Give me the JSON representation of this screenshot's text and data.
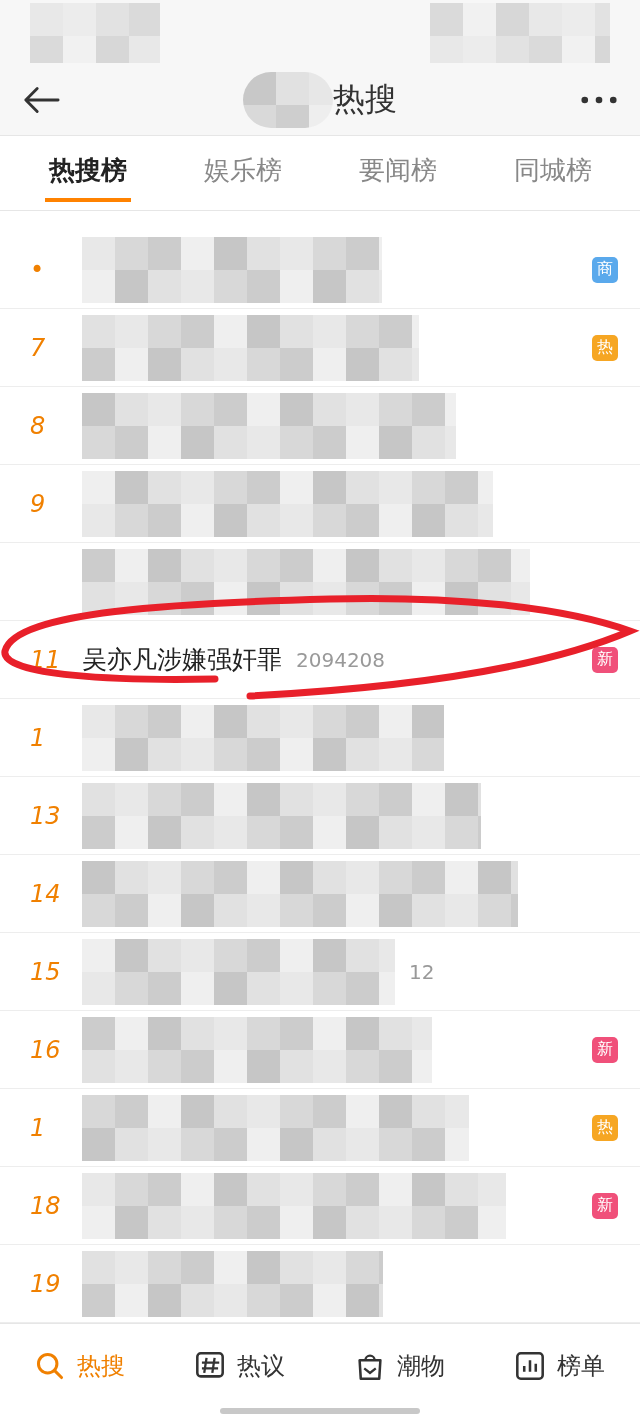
{
  "header": {
    "title": "热搜"
  },
  "tabs": [
    {
      "label": "热搜榜",
      "selected": true
    },
    {
      "label": "娱乐榜",
      "selected": false
    },
    {
      "label": "要闻榜",
      "selected": false
    },
    {
      "label": "同城榜",
      "selected": false
    }
  ],
  "rows": [
    {
      "rank": "•",
      "badge": "商",
      "color": "#5aa9ec",
      "blurred": true
    },
    {
      "rank": "7",
      "badge": "热",
      "color": "#f6a623",
      "blurred": true
    },
    {
      "rank": "8",
      "blurred": true
    },
    {
      "rank": "9",
      "blurred": true
    },
    {
      "blurred": true
    },
    {
      "rank": "11",
      "title": "吴亦凡涉嫌强奸罪",
      "count": "2094208",
      "badge": "新",
      "color": "#f0507a",
      "blurred": false,
      "circled": true
    },
    {
      "rank": "1",
      "blurred": true
    },
    {
      "rank": "13",
      "blurred": true
    },
    {
      "rank": "14",
      "blurred": true
    },
    {
      "rank": "15",
      "count": "12",
      "blurred": true
    },
    {
      "rank": "16",
      "badge": "新",
      "color": "#f0507a",
      "blurred": true
    },
    {
      "rank": "1",
      "badge": "热",
      "color": "#f6a623",
      "blurred": true
    },
    {
      "rank": "18",
      "badge": "新",
      "color": "#f0507a",
      "blurred": true
    },
    {
      "rank": "19",
      "blurred": true
    }
  ],
  "bottom_nav": [
    {
      "label": "热搜",
      "selected": true
    },
    {
      "label": "热议",
      "selected": false
    },
    {
      "label": "潮物",
      "selected": false
    },
    {
      "label": "榜单",
      "selected": false
    }
  ]
}
